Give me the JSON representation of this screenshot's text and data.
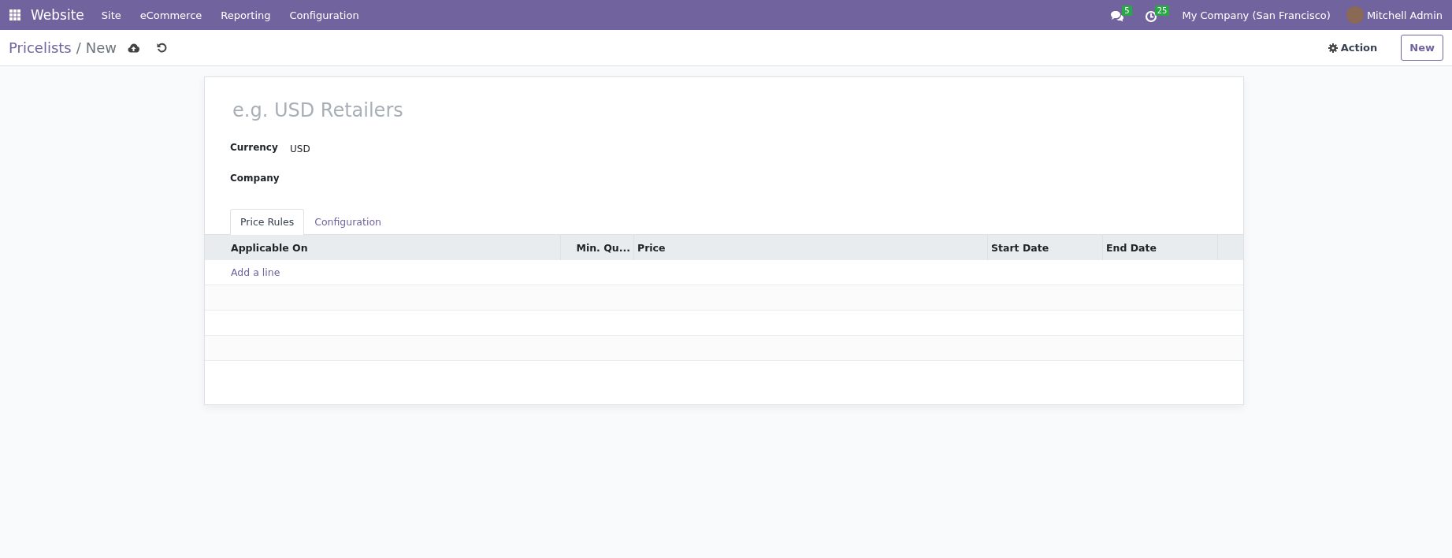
{
  "navbar": {
    "app_name": "Website",
    "menu": [
      "Site",
      "eCommerce",
      "Reporting",
      "Configuration"
    ],
    "messages_count": "5",
    "activities_count": "25",
    "company": "My Company (San Francisco)",
    "user": "Mitchell Admin"
  },
  "control_panel": {
    "breadcrumb": "Pricelists",
    "separator": "/",
    "current": "New",
    "action": "Action",
    "new_button": "New"
  },
  "form": {
    "name": {
      "placeholder": "e.g. USD Retailers"
    },
    "fields": [
      {
        "label": "Currency",
        "value": "USD"
      },
      {
        "label": "Company"
      }
    ],
    "tabs": [
      {
        "label": "Price Rules",
        "selected": true
      },
      {
        "label": "Configuration",
        "selected": false
      }
    ],
    "table": {
      "columns": [
        {
          "label": "Applicable On",
          "kind": "text"
        },
        {
          "label": "Min. Qu...",
          "kind": "number"
        },
        {
          "label": "Price",
          "kind": "text"
        },
        {
          "label": "Start Date",
          "kind": "text"
        },
        {
          "label": "End Date",
          "kind": "text"
        }
      ],
      "add_line": "Add a line"
    }
  }
}
